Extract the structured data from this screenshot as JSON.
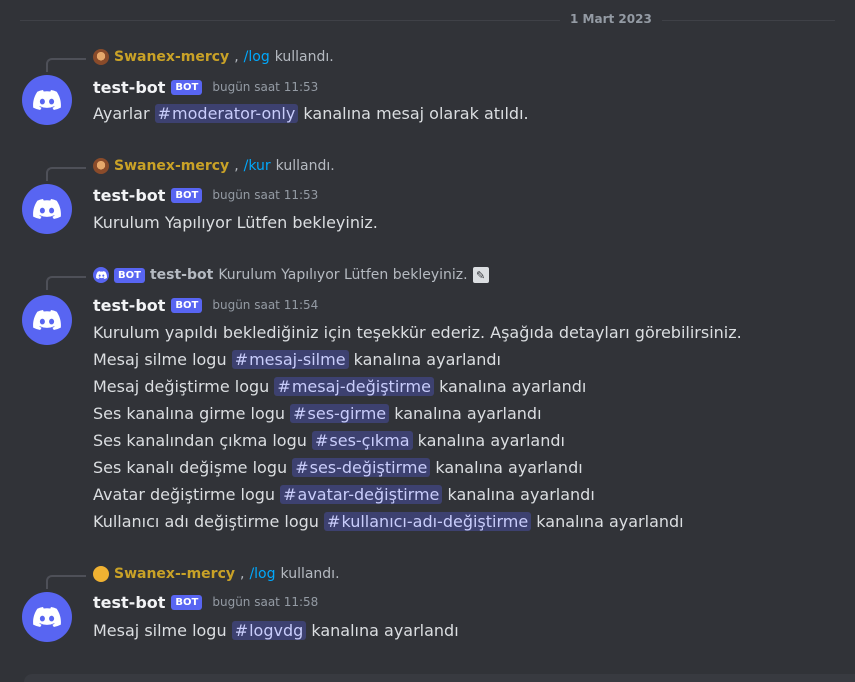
{
  "date_divider": "1 Mart 2023",
  "colors": {
    "background": "#313338",
    "blurple": "#5865f2",
    "reply_name": "#c9a227",
    "command": "#00a8fc"
  },
  "messages": [
    {
      "reply": {
        "name": "Swanex-mercy",
        "command": "/log",
        "text": "kullandı."
      },
      "author": "test-bot",
      "bot_tag": "BOT",
      "time": "bugün saat 11:53",
      "lines": [
        {
          "before": "Ayarlar ",
          "mention": "moderator-only",
          "after": " kanalına mesaj olarak atıldı."
        }
      ]
    },
    {
      "reply": {
        "name": "Swanex-mercy",
        "command": "/kur",
        "text": "kullandı."
      },
      "author": "test-bot",
      "bot_tag": "BOT",
      "time": "bugün saat 11:53",
      "lines": [
        {
          "before": "Kurulum Yapılıyor Lütfen bekleyiniz."
        }
      ]
    },
    {
      "reply": {
        "bot_tag": "BOT",
        "name": "test-bot",
        "text": "Kurulum Yapılıyor Lütfen bekleyiniz."
      },
      "author": "test-bot",
      "bot_tag": "BOT",
      "time": "bugün saat 11:54",
      "lines": [
        {
          "before": "Kurulum yapıldı beklediğiniz için teşekkür ederiz. Aşağıda detayları görebilirsiniz."
        },
        {
          "before": "Mesaj silme logu ",
          "mention": "mesaj-silme",
          "after": " kanalına ayarlandı"
        },
        {
          "before": "Mesaj değiştirme logu ",
          "mention": "mesaj-değiştirme",
          "after": " kanalına ayarlandı"
        },
        {
          "before": "Ses kanalına girme logu ",
          "mention": "ses-girme",
          "after": " kanalına ayarlandı"
        },
        {
          "before": "Ses kanalından çıkma logu ",
          "mention": "ses-çıkma",
          "after": " kanalına ayarlandı"
        },
        {
          "before": "Ses kanalı değişme logu ",
          "mention": "ses-değiştirme",
          "after": " kanalına ayarlandı"
        },
        {
          "before": "Avatar değiştirme logu ",
          "mention": "avatar-değiştirme",
          "after": " kanalına ayarlandı"
        },
        {
          "before": "Kullanıcı adı değiştirme logu ",
          "mention": "kullanıcı-adı-değiştirme",
          "after": " kanalına ayarlandı"
        }
      ]
    },
    {
      "reply": {
        "name": "Swanex--mercy",
        "command": "/log",
        "text": "kullandı."
      },
      "author": "test-bot",
      "bot_tag": "BOT",
      "time": "bugün saat 11:58",
      "lines": [
        {
          "before": "Mesaj silme logu ",
          "mention": "logvdg",
          "after": " kanalına ayarlandı"
        }
      ]
    }
  ]
}
